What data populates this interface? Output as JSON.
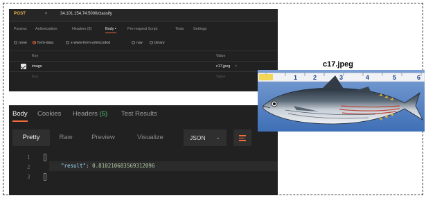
{
  "request": {
    "method": "POST",
    "url": "34.101.154.74:5000/classify",
    "tabs": [
      "Params",
      "Authorization",
      "Headers (8)",
      "Body •",
      "Pre-request Script",
      "Tests",
      "Settings"
    ],
    "body_options": [
      "none",
      "form-data",
      "x-www-form-urlencoded",
      "raw",
      "binary"
    ],
    "selected_body_option": "form-data",
    "table_headers": {
      "key": "Key",
      "value": "Value"
    },
    "row": {
      "key": "image",
      "value": "c17.jpeg"
    },
    "placeholder_row": {
      "key": "Key",
      "value": "Value"
    }
  },
  "response": {
    "tabs": {
      "body": "Body",
      "cookies": "Cookies",
      "headers": "Headers",
      "headers_count": "(5)",
      "test_results": "Test Results"
    },
    "views": [
      "Pretty",
      "Raw",
      "Preview",
      "Visualize"
    ],
    "active_view": "Pretty",
    "format": "JSON",
    "line_numbers": [
      "1",
      "2",
      "3"
    ],
    "result_key": "\"result\"",
    "result_value": "0.810210683569312096"
  },
  "image_panel": {
    "filename": "c17.jpeg",
    "ruler_numbers": [
      "1",
      "2",
      "3",
      "4",
      "5",
      "6"
    ],
    "icon": "fish-photo"
  },
  "colors": {
    "accent": "#f26b3a",
    "method": "#f2b84b",
    "count": "#4cc16f",
    "panel_bg": "#212121"
  }
}
